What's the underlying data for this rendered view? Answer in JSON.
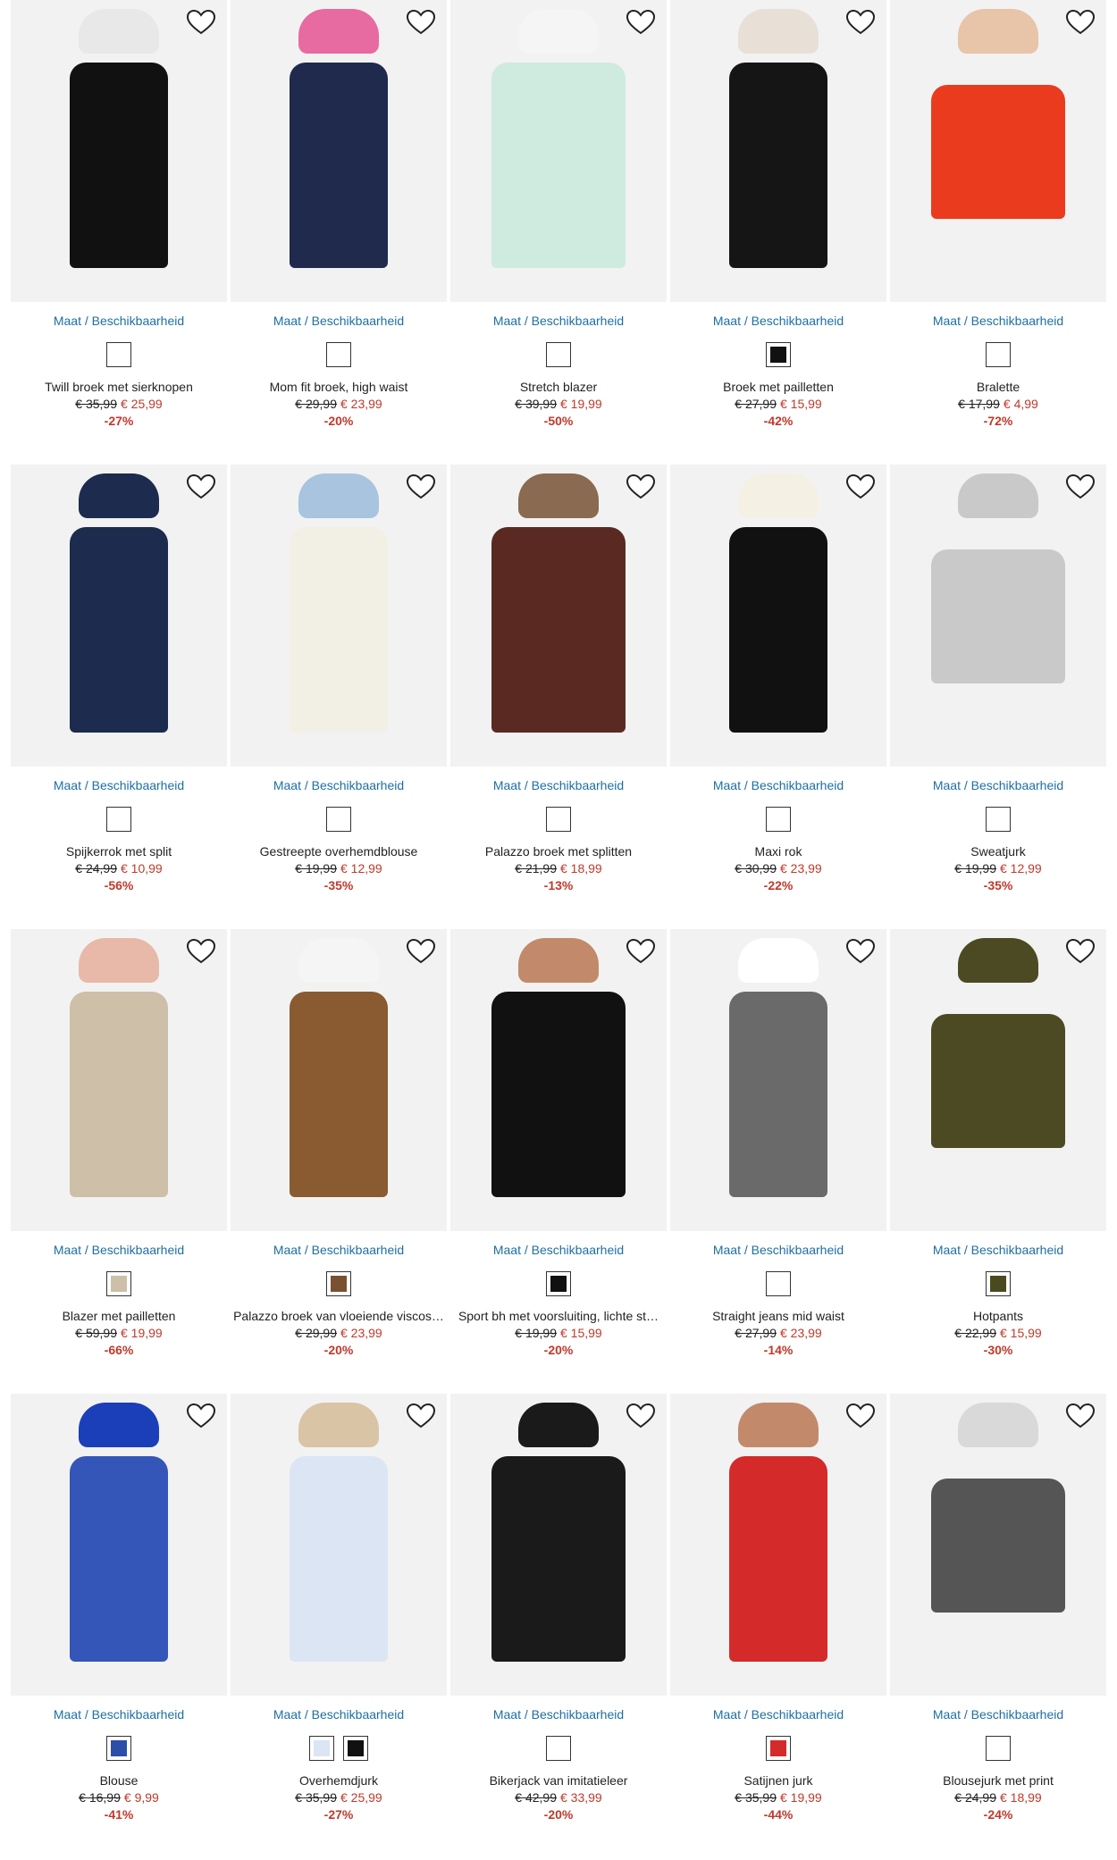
{
  "size_link_label": "Maat / Beschikbaarheid",
  "accent_color": "#1d6fa3",
  "sale_color": "#c0392b",
  "products": [
    {
      "name": "Twill broek met sierknopen",
      "old_price": "€ 35,99",
      "new_price": "€ 25,99",
      "discount": "-27%",
      "swatches": [
        "#ffffff"
      ],
      "colors": [
        "#111111",
        "#e8e8e8"
      ]
    },
    {
      "name": "Mom fit broek, high waist",
      "old_price": "€ 29,99",
      "new_price": "€ 23,99",
      "discount": "-20%",
      "swatches": [
        "#ffffff"
      ],
      "colors": [
        "#1f2a4d",
        "#e76aa0"
      ]
    },
    {
      "name": "Stretch blazer",
      "old_price": "€ 39,99",
      "new_price": "€ 19,99",
      "discount": "-50%",
      "swatches": [
        "#ffffff"
      ],
      "colors": [
        "#cfeadf",
        "#f5f5f5"
      ]
    },
    {
      "name": "Broek met pailletten",
      "old_price": "€ 27,99",
      "new_price": "€ 15,99",
      "discount": "-42%",
      "swatches": [
        "#111111"
      ],
      "colors": [
        "#151515",
        "#e8e0d6"
      ]
    },
    {
      "name": "Bralette",
      "old_price": "€ 17,99",
      "new_price": "€ 4,99",
      "discount": "-72%",
      "swatches": [
        "#ffffff"
      ],
      "colors": [
        "#ea3b1f",
        "#e8c4a8"
      ]
    },
    {
      "name": "Spijkerrok met split",
      "old_price": "€ 24,99",
      "new_price": "€ 10,99",
      "discount": "-56%",
      "swatches": [
        "#ffffff"
      ],
      "colors": [
        "#1c2b4e",
        "#1c2b4e"
      ]
    },
    {
      "name": "Gestreepte overhemdblouse",
      "old_price": "€ 19,99",
      "new_price": "€ 12,99",
      "discount": "-35%",
      "swatches": [
        "#ffffff"
      ],
      "colors": [
        "#f2efe4",
        "#a8c4de"
      ]
    },
    {
      "name": "Palazzo broek met splitten",
      "old_price": "€ 21,99",
      "new_price": "€ 18,99",
      "discount": "-13%",
      "swatches": [
        "#ffffff"
      ],
      "colors": [
        "#5a2a22",
        "#8a6a50"
      ]
    },
    {
      "name": "Maxi rok",
      "old_price": "€ 30,99",
      "new_price": "€ 23,99",
      "discount": "-22%",
      "swatches": [
        "#ffffff"
      ],
      "colors": [
        "#111111",
        "#f4f0e4"
      ]
    },
    {
      "name": "Sweatjurk",
      "old_price": "€ 19,99",
      "new_price": "€ 12,99",
      "discount": "-35%",
      "swatches": [
        "#ffffff"
      ],
      "colors": [
        "#c9c9c9",
        "#c9c9c9"
      ]
    },
    {
      "name": "Blazer met pailletten",
      "old_price": "€ 59,99",
      "new_price": "€ 19,99",
      "discount": "-66%",
      "swatches": [
        "#cdbfa8"
      ],
      "colors": [
        "#cdbfa8",
        "#e8b9a8"
      ]
    },
    {
      "name": "Palazzo broek van vloeiende viscos…",
      "old_price": "€ 29,99",
      "new_price": "€ 23,99",
      "discount": "-20%",
      "swatches": [
        "#7a5030"
      ],
      "colors": [
        "#8a5a30",
        "#f5f5f5"
      ]
    },
    {
      "name": "Sport bh met voorsluiting, lichte st…",
      "old_price": "€ 19,99",
      "new_price": "€ 15,99",
      "discount": "-20%",
      "swatches": [
        "#111111"
      ],
      "colors": [
        "#111111",
        "#c28a6a"
      ]
    },
    {
      "name": "Straight jeans mid waist",
      "old_price": "€ 27,99",
      "new_price": "€ 23,99",
      "discount": "-14%",
      "swatches": [
        "#ffffff"
      ],
      "colors": [
        "#6a6a6a",
        "#ffffff"
      ]
    },
    {
      "name": "Hotpants",
      "old_price": "€ 22,99",
      "new_price": "€ 15,99",
      "discount": "-30%",
      "swatches": [
        "#4a4a20"
      ],
      "colors": [
        "#4c4a22",
        "#4c4a22"
      ]
    },
    {
      "name": "Blouse",
      "old_price": "€ 16,99",
      "new_price": "€ 9,99",
      "discount": "-41%",
      "swatches": [
        "#2b4fa8"
      ],
      "colors": [
        "#3456b8",
        "#1a3fb8"
      ]
    },
    {
      "name": "Overhemdjurk",
      "old_price": "€ 35,99",
      "new_price": "€ 25,99",
      "discount": "-27%",
      "swatches": [
        "#dbe5f4",
        "#111111"
      ],
      "colors": [
        "#dbe5f4",
        "#d9c4a6"
      ]
    },
    {
      "name": "Bikerjack van imitatieleer",
      "old_price": "€ 42,99",
      "new_price": "€ 33,99",
      "discount": "-20%",
      "swatches": [
        "#ffffff"
      ],
      "colors": [
        "#1a1a1a",
        "#1a1a1a"
      ]
    },
    {
      "name": "Satijnen jurk",
      "old_price": "€ 35,99",
      "new_price": "€ 19,99",
      "discount": "-44%",
      "swatches": [
        "#d42a2a"
      ],
      "colors": [
        "#d42a2a",
        "#c28a6a"
      ]
    },
    {
      "name": "Blousejurk met print",
      "old_price": "€ 24,99",
      "new_price": "€ 18,99",
      "discount": "-24%",
      "swatches": [
        "#ffffff"
      ],
      "colors": [
        "#555555",
        "#d9d9d9"
      ]
    }
  ]
}
